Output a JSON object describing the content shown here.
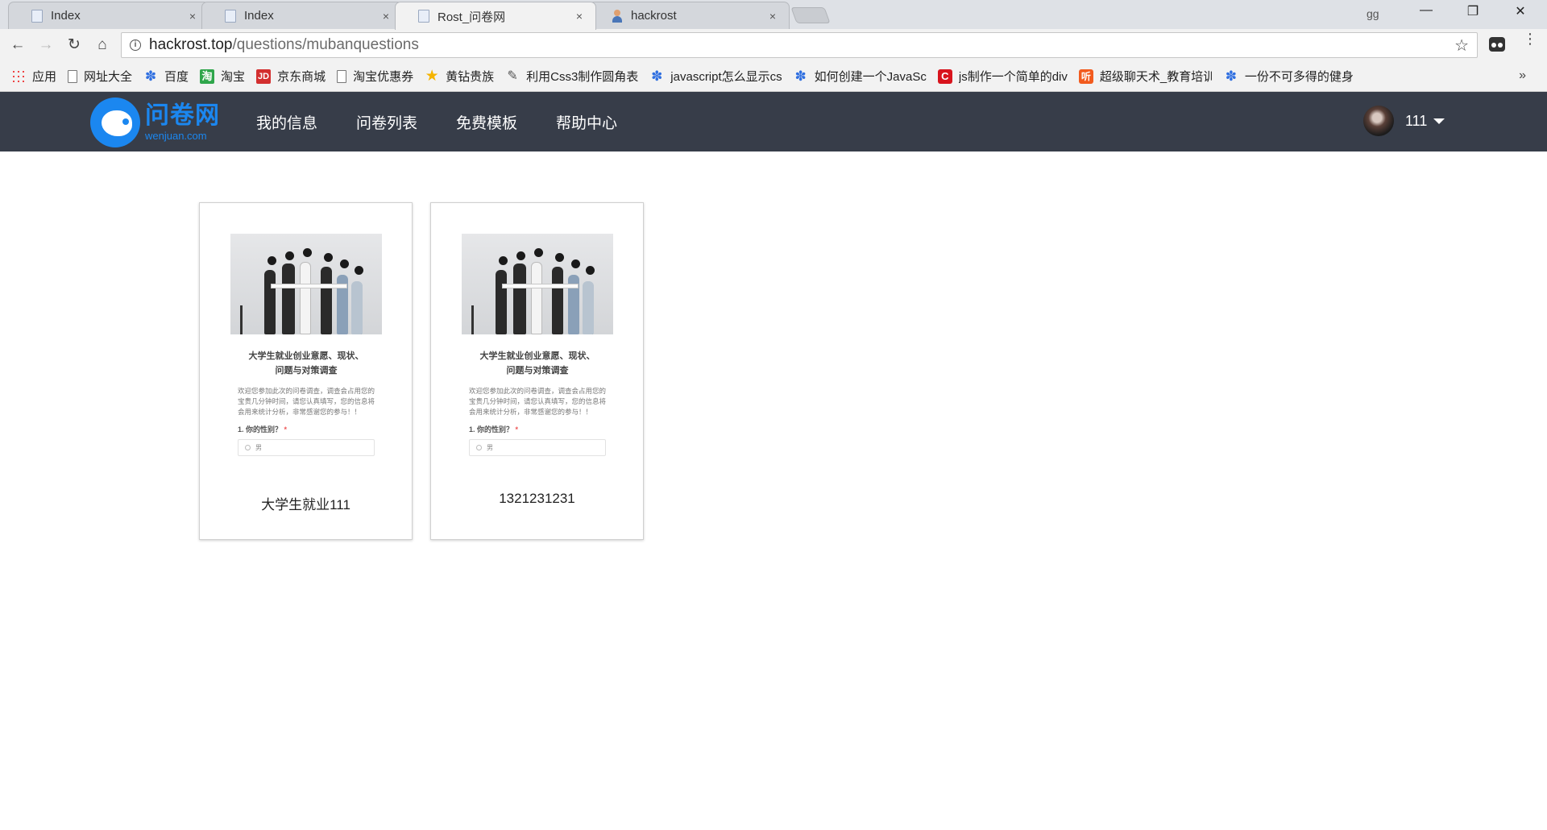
{
  "browser": {
    "tabs": [
      {
        "title": "Index",
        "icon": "page-icon",
        "close": "×"
      },
      {
        "title": "Index",
        "icon": "page-icon",
        "close": "×"
      },
      {
        "title": "Rost_问卷网",
        "icon": "page-icon",
        "close": "×"
      },
      {
        "title": "hackrost",
        "icon": "person-icon",
        "close": "×"
      }
    ],
    "profile_label": "gg",
    "window_controls": {
      "minimize": "—",
      "restore": "❐",
      "close": "✕"
    },
    "address": {
      "host": "hackrost.top",
      "path": "/questions/mubanquestions"
    },
    "nav": {
      "back": "←",
      "forward": "→",
      "reload": "↻",
      "home": "⌂",
      "star": "☆",
      "info": "i",
      "menu": "⋮"
    },
    "bookmarks": [
      {
        "label": "应用",
        "icon": "apps-icon",
        "glyph": ""
      },
      {
        "label": "网址大全",
        "icon": "page-icon",
        "glyph": ""
      },
      {
        "label": "百度",
        "icon": "baidu-paw-icon",
        "glyph": "✽"
      },
      {
        "label": "淘宝",
        "icon": "taobao-icon",
        "glyph": "淘"
      },
      {
        "label": "京东商城",
        "icon": "jd-icon",
        "glyph": "JD"
      },
      {
        "label": "淘宝优惠券",
        "icon": "page-icon",
        "glyph": ""
      },
      {
        "label": "黄钻贵族",
        "icon": "star-icon",
        "glyph": "★"
      },
      {
        "label": "利用Css3制作圆角表",
        "icon": "pen-icon",
        "glyph": "✎"
      },
      {
        "label": "javascript怎么显示cs",
        "icon": "baidu-paw-icon",
        "glyph": "✽"
      },
      {
        "label": "如何创建一个JavaSc",
        "icon": "baidu-paw-icon",
        "glyph": "✽"
      },
      {
        "label": "js制作一个简单的div",
        "icon": "csdn-icon",
        "glyph": "C"
      },
      {
        "label": "超级聊天术_教育培训",
        "icon": "ting-icon",
        "glyph": "听"
      },
      {
        "label": "一份不可多得的健身",
        "icon": "baidu-paw-icon",
        "glyph": "✽"
      }
    ],
    "bookmarks_more": "»"
  },
  "site": {
    "logo": {
      "cn": "问卷网",
      "en": "wenjuan.com"
    },
    "nav": [
      "我的信息",
      "问卷列表",
      "免费模板",
      "帮助中心"
    ],
    "user": {
      "name": "111"
    }
  },
  "templates": [
    {
      "preview": {
        "title_line1": "大学生就业创业意愿、现状、",
        "title_line2": "问题与对策调查",
        "description": "欢迎您参加此次的问卷调查，调查会占用您的宝贵几分钟时间，请您认真填写，您的信息将会用来统计分析，非常感谢您的参与！！",
        "question": "1. 你的性别？",
        "required_mark": "*",
        "option": "男"
      },
      "name": "大学生就业111"
    },
    {
      "preview": {
        "title_line1": "大学生就业创业意愿、现状、",
        "title_line2": "问题与对策调查",
        "description": "欢迎您参加此次的问卷调查，调查会占用您的宝贵几分钟时间，请您认真填写，您的信息将会用来统计分析，非常感谢您的参与！！",
        "question": "1. 你的性别？",
        "required_mark": "*",
        "option": "男"
      },
      "name": "1321231231"
    }
  ],
  "colors": {
    "header_bg": "#373d49",
    "brand_blue": "#1b87f0"
  }
}
